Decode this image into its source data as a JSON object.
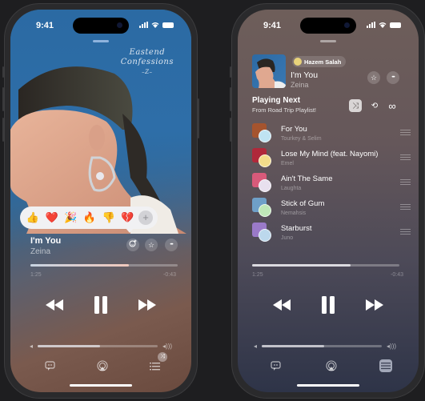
{
  "status_bar": {
    "time": "9:41"
  },
  "now_playing": {
    "album_cover_text": [
      "Eastend",
      "Confessions",
      "–Z–"
    ],
    "title": "I'm You",
    "artist": "Zeina",
    "elapsed": "1:25",
    "remaining": "-0:43",
    "progress_fraction": 0.67,
    "volume_fraction": 0.52
  },
  "reactions": {
    "items": [
      {
        "name": "thumbs-up",
        "glyph": "👍"
      },
      {
        "name": "heart",
        "glyph": "❤️"
      },
      {
        "name": "party-popper",
        "glyph": "🎉"
      },
      {
        "name": "fire",
        "glyph": "🔥"
      },
      {
        "name": "thumbs-down",
        "glyph": "👎"
      },
      {
        "name": "broken-heart",
        "glyph": "💔"
      }
    ],
    "more_label": "+"
  },
  "queue_view": {
    "shared_by": "Hazem Salah",
    "title": "I'm You",
    "artist": "Zeina",
    "playing_next_heading": "Playing Next",
    "playing_next_source": "From Road Trip Playlist!",
    "elapsed": "1:25",
    "remaining": "-0:43",
    "progress_fraction": 0.67,
    "volume_fraction": 0.52,
    "items": [
      {
        "title": "For You",
        "artist": "Tourkey & Selim",
        "art_color": "#a5542e",
        "avatar_color": "#bfe3f2"
      },
      {
        "title": "Lose My Mind (feat. Nayomi)",
        "artist": "Emel",
        "art_color": "#b0283a",
        "avatar_color": "#f3dc8a"
      },
      {
        "title": "Ain't The Same",
        "artist": "Laughta",
        "art_color": "#d85a7a",
        "avatar_color": "#e8e0ee"
      },
      {
        "title": "Stick of Gum",
        "artist": "Nemahsis",
        "art_color": "#6fa0c8",
        "avatar_color": "#bfe8b8"
      },
      {
        "title": "Starburst",
        "artist": "Juno",
        "art_color": "#9a7ac8",
        "avatar_color": "#bcd8ec"
      }
    ]
  },
  "icons": {
    "star": "☆",
    "more": "•••",
    "shuffle": "⤨",
    "repeat": "⟲",
    "infinity": "∞",
    "rewind": "◀◀",
    "fast_forward": "▶▶",
    "pause": "❚❚",
    "volume_low": "◂",
    "volume_high": "◂)))"
  }
}
